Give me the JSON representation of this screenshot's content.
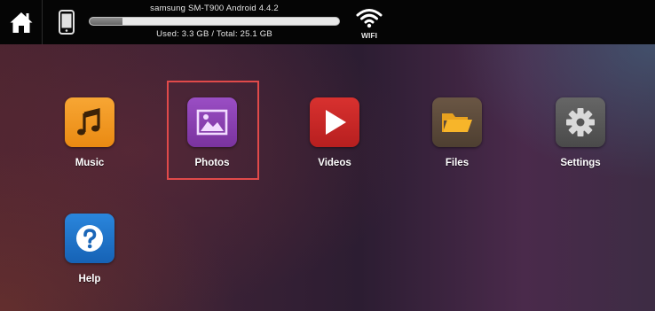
{
  "header": {
    "device_name": "samsung SM-T900 Android 4.4.2",
    "storage_text": "Used: 3.3 GB / Total: 25.1 GB",
    "storage_used_fraction": 0.13,
    "wifi_label": "WIFI"
  },
  "apps": [
    {
      "label": "Music",
      "icon": "music-note-icon",
      "color": "#f29a22"
    },
    {
      "label": "Photos",
      "icon": "image-icon",
      "color": "#8a3fb0",
      "selected": true
    },
    {
      "label": "Videos",
      "icon": "play-icon",
      "color": "#cc2a2a"
    },
    {
      "label": "Files",
      "icon": "folder-icon",
      "color": "#5c4a3a"
    },
    {
      "label": "Settings",
      "icon": "gear-icon",
      "color": "#5a5a5a"
    },
    {
      "label": "Help",
      "icon": "question-icon",
      "color": "#1f74c9"
    }
  ],
  "colors": {
    "selection_border": "#e04a4a",
    "topbar": "#050505"
  }
}
